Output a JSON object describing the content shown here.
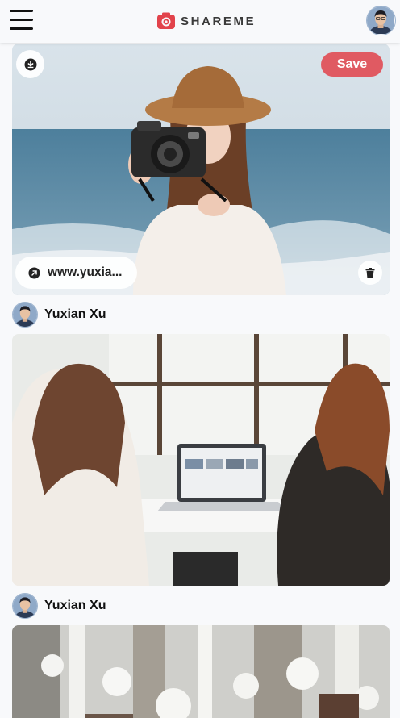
{
  "app": {
    "name": "SHAREME"
  },
  "header": {
    "menu_icon": "hamburger-menu-icon",
    "logo_icon": "camera-icon",
    "avatar_icon": "user-avatar"
  },
  "pins": [
    {
      "image": "woman-with-camera-at-beach-photo",
      "save_label": "Save",
      "download_icon": "download-icon",
      "link_text": "www.yuxia...",
      "link_icon": "arrow-up-right-icon",
      "delete_icon": "trash-icon",
      "author": "Yuxian Xu"
    },
    {
      "image": "two-women-at-laptop-photo",
      "author": "Yuxian Xu"
    },
    {
      "image": "white-flowers-window-photo"
    }
  ],
  "colors": {
    "save_button": "#e05a62",
    "logo_red": "#e2434b",
    "background": "#f8f9fb"
  }
}
